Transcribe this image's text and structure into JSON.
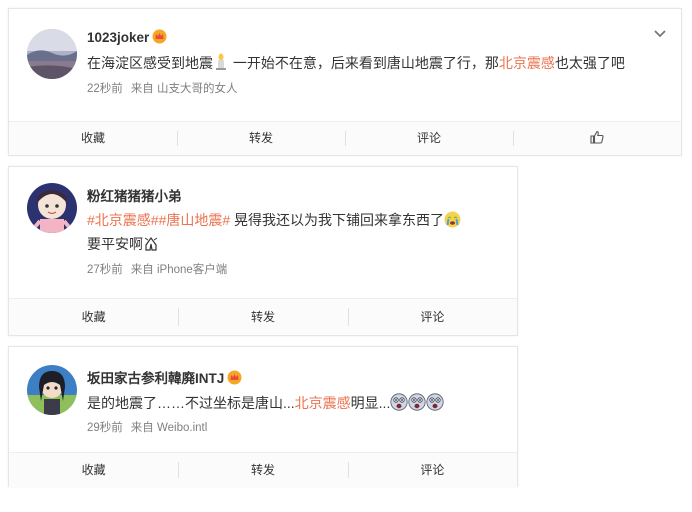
{
  "posts": [
    {
      "user": "1023joker",
      "text_1": "在海淀区感受到地震",
      "text_2": "一开始不在意，后来看到唐山地震了行，那",
      "highlight": "北京震感",
      "text_3": "也太强了吧",
      "time": "22秒前",
      "source_prefix": "来自",
      "source": "山支大哥的女人",
      "actions": [
        "收藏",
        "转发",
        "评论"
      ]
    },
    {
      "user": "粉红猪猪猪小弟",
      "tag_1": "#北京震感#",
      "tag_2": "#唐山地震#",
      "text_1": "晃得我还以为我下铺回来拿东西了",
      "text_2": "要平安啊",
      "time": "27秒前",
      "source_prefix": "来自",
      "source": "iPhone客户端",
      "actions": [
        "收藏",
        "转发",
        "评论"
      ]
    },
    {
      "user": "坂田家古参利韓廃INTJ",
      "text_1": "是的地震了……不过坐标是唐山...",
      "highlight": "北京震感",
      "text_2": "明显...",
      "time": "29秒前",
      "source_prefix": "来自",
      "source": "Weibo.intl",
      "actions": [
        "收藏",
        "转发",
        "评论"
      ]
    }
  ],
  "colors": {
    "highlight": "#eb7350",
    "meta": "#808080",
    "text": "#333333"
  }
}
